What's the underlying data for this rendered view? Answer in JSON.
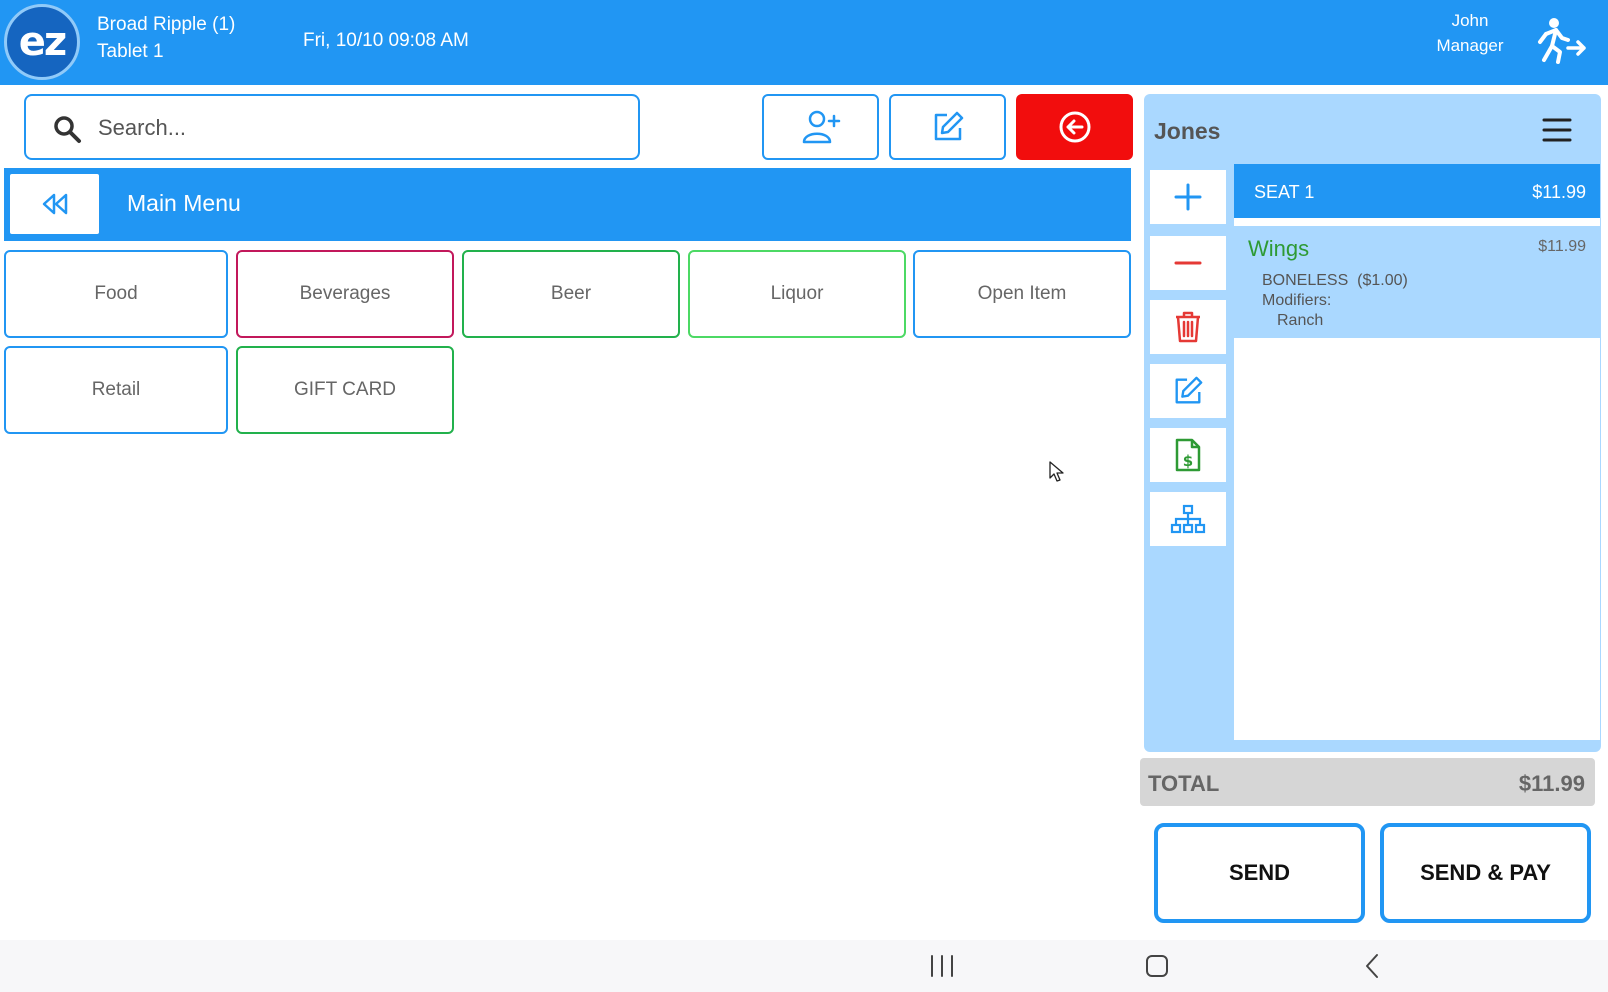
{
  "header": {
    "logo_text": "ez",
    "location": "Broad Ripple (1)",
    "device": "Tablet 1",
    "datetime": "Fri, 10/10 09:08 AM",
    "user_name": "John",
    "user_role": "Manager",
    "brand_color": "#2196f3"
  },
  "search": {
    "placeholder": "Search..."
  },
  "actions": {
    "add_customer_icon": "user-plus-icon",
    "edit_icon": "edit-icon",
    "exit_icon": "circle-arrow-left-icon",
    "exit_color": "#f20d0d"
  },
  "menu": {
    "title": "Main Menu",
    "categories": [
      {
        "label": "Food",
        "color": "#2196f3"
      },
      {
        "label": "Beverages",
        "color": "#c2185b"
      },
      {
        "label": "Beer",
        "color": "#22b14c"
      },
      {
        "label": "Liquor",
        "color": "#4cd964"
      },
      {
        "label": "Open Item",
        "color": "#2196f3"
      },
      {
        "label": "Retail",
        "color": "#2196f3"
      },
      {
        "label": "GIFT CARD",
        "color": "#22b14c"
      }
    ]
  },
  "ticket": {
    "name": "Jones",
    "seat": {
      "label": "SEAT 1",
      "amount": "$11.99"
    },
    "items": [
      {
        "name": "Wings",
        "price": "$11.99",
        "option": "BONELESS  ($1.00)",
        "modifiers_label": "Modifiers:",
        "modifier": "Ranch"
      }
    ],
    "total_label": "TOTAL",
    "total_amount": "$11.99"
  },
  "buttons": {
    "send": "SEND",
    "send_pay": "SEND & PAY"
  }
}
